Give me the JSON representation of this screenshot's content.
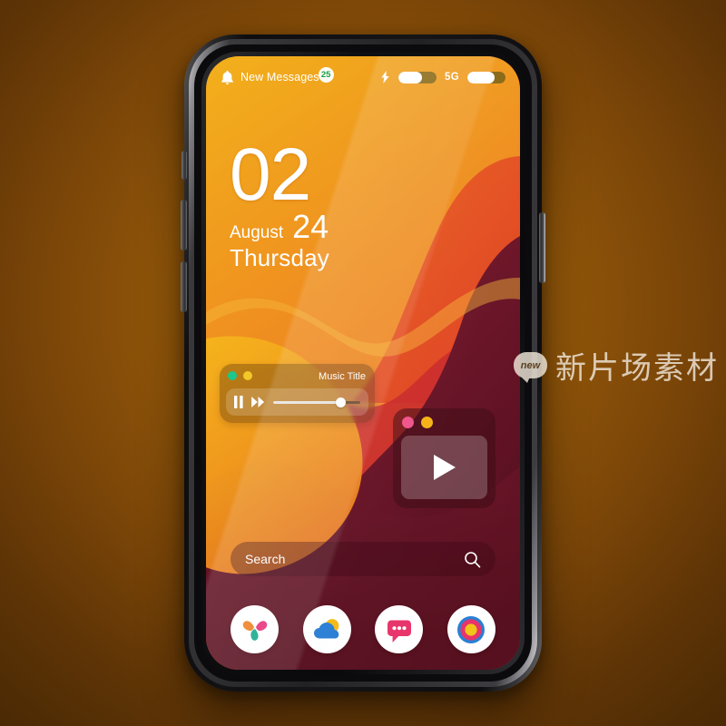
{
  "wallpaper": {
    "colors": {
      "top_orange": "#f0a81e",
      "mid_orange": "#ef7f22",
      "deep_orange": "#e4561f",
      "red": "#d8352a",
      "maroon": "#6e1327",
      "dark_maroon": "#51101f",
      "plum": "#7a1f34"
    }
  },
  "status_bar": {
    "bell_icon": "bell-icon",
    "notification_label": "New Messages",
    "badge_count": "25",
    "badge_color": "#18a046",
    "flash_icon": "flash-icon",
    "battery_level_percent": 62,
    "network_label": "5G",
    "signal_level_percent": 72
  },
  "clock": {
    "hour": "02",
    "month": "August",
    "day": "24",
    "weekday": "Thursday"
  },
  "music_widget": {
    "title": "Music Title",
    "dot_1_color": "#19c88c",
    "dot_2_color": "#f2c828",
    "pause_icon": "pause-icon",
    "forward_icon": "fast-forward-icon",
    "progress_percent": 78
  },
  "video_widget": {
    "dot_1_color": "#f0558c",
    "dot_2_color": "#f6b317",
    "play_icon": "play-icon"
  },
  "search": {
    "placeholder": "Search",
    "value": "",
    "icon": "search-icon"
  },
  "dock": {
    "apps": [
      {
        "name": "photos-app",
        "icon": "flower-petals-icon",
        "colors": [
          "#ef8022",
          "#e8317a",
          "#17a98c"
        ]
      },
      {
        "name": "weather-app",
        "icon": "cloud-sun-icon",
        "colors": [
          "#2a7fd4",
          "#f5b917"
        ]
      },
      {
        "name": "messages-app",
        "icon": "chat-bubble-icon",
        "colors": [
          "#e8336b",
          "#ffffff"
        ]
      },
      {
        "name": "target-app",
        "icon": "concentric-target-icon",
        "colors": [
          "#2a7fd4",
          "#e8336b",
          "#f0c419"
        ]
      }
    ]
  },
  "watermark": {
    "logo_text": "new",
    "text": "新片场素材"
  }
}
